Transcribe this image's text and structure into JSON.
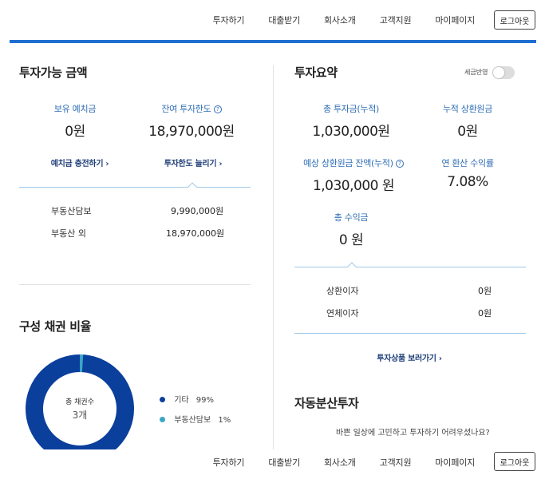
{
  "nav": {
    "items": [
      "투자하기",
      "대출받기",
      "회사소개",
      "고객지원",
      "마이페이지"
    ],
    "logout_label": "로그아웃"
  },
  "left": {
    "title": "투자가능 금액",
    "balance_label": "보유 예치금",
    "balance_value": "0원",
    "limit_label": "잔여 투자한도",
    "limit_value": "18,970,000원",
    "deposit_link": "예치금 충전하기",
    "raise_limit_link": "투자한도 늘리기",
    "rows": [
      {
        "label": "부동산담보",
        "value": "9,990,000원"
      },
      {
        "label": "부동산 외",
        "value": "18,970,000원"
      }
    ]
  },
  "bonds": {
    "title": "구성 채권 비율",
    "center_label": "총 채권수",
    "center_value": "3개",
    "legend": [
      {
        "label": "기타",
        "percent": "99%",
        "color": "#0b3f9c",
        "value": 99
      },
      {
        "label": "부동산담보",
        "percent": "1%",
        "color": "#3aa6c5",
        "value": 1
      }
    ]
  },
  "summary": {
    "title": "투자요약",
    "tax_label": "세금반영",
    "total_invest_label": "총 투자금(누적)",
    "total_invest_value": "1,030,000원",
    "repaid_label": "누적 상환원금",
    "repaid_value": "0원",
    "expected_label": "예상 상환원금 잔액(누적)",
    "expected_value": "1,030,000 원",
    "annual_label": "연 환산 수익률",
    "annual_value": "7.08%",
    "total_profit_label": "총 수익금",
    "total_profit_value": "0 원",
    "rows": [
      {
        "label": "상환이자",
        "value": "0원"
      },
      {
        "label": "연체이자",
        "value": "0원"
      }
    ],
    "products_link": "투자상품 보러가기"
  },
  "auto": {
    "title": "자동분산투자",
    "desc": "바쁜 일상에 고민하고 투자하기 어려우셨나요?"
  }
}
